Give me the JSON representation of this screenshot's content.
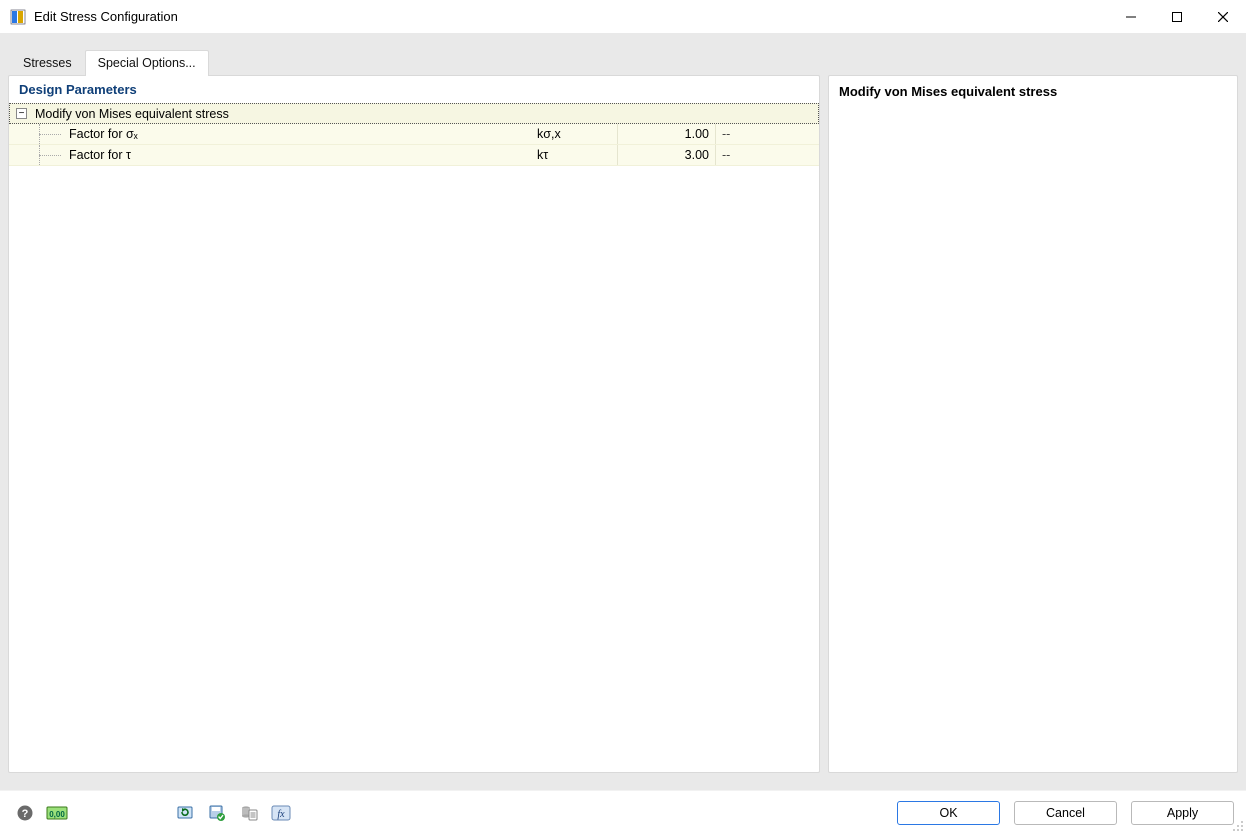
{
  "window": {
    "title": "Edit Stress Configuration"
  },
  "tabs": [
    {
      "label": "Stresses",
      "active": false
    },
    {
      "label": "Special Options...",
      "active": true
    }
  ],
  "left_panel": {
    "title": "Design Parameters",
    "group_label": "Modify von Mises equivalent stress",
    "rows": [
      {
        "name": "Factor for σₓ",
        "symbol": "kσ,x",
        "value": "1.00",
        "unit": "--"
      },
      {
        "name": "Factor for τ",
        "symbol": "kτ",
        "value": "3.00",
        "unit": "--"
      }
    ]
  },
  "right_panel": {
    "heading": "Modify von Mises equivalent stress"
  },
  "footer_icons": {
    "help": "help-icon",
    "units": "units-icon",
    "refresh": "refresh-icon",
    "save_config": "save-config-icon",
    "clipboard": "clipboard-db-icon",
    "fx": "fx-icon"
  },
  "buttons": {
    "ok": "OK",
    "cancel": "Cancel",
    "apply": "Apply"
  }
}
